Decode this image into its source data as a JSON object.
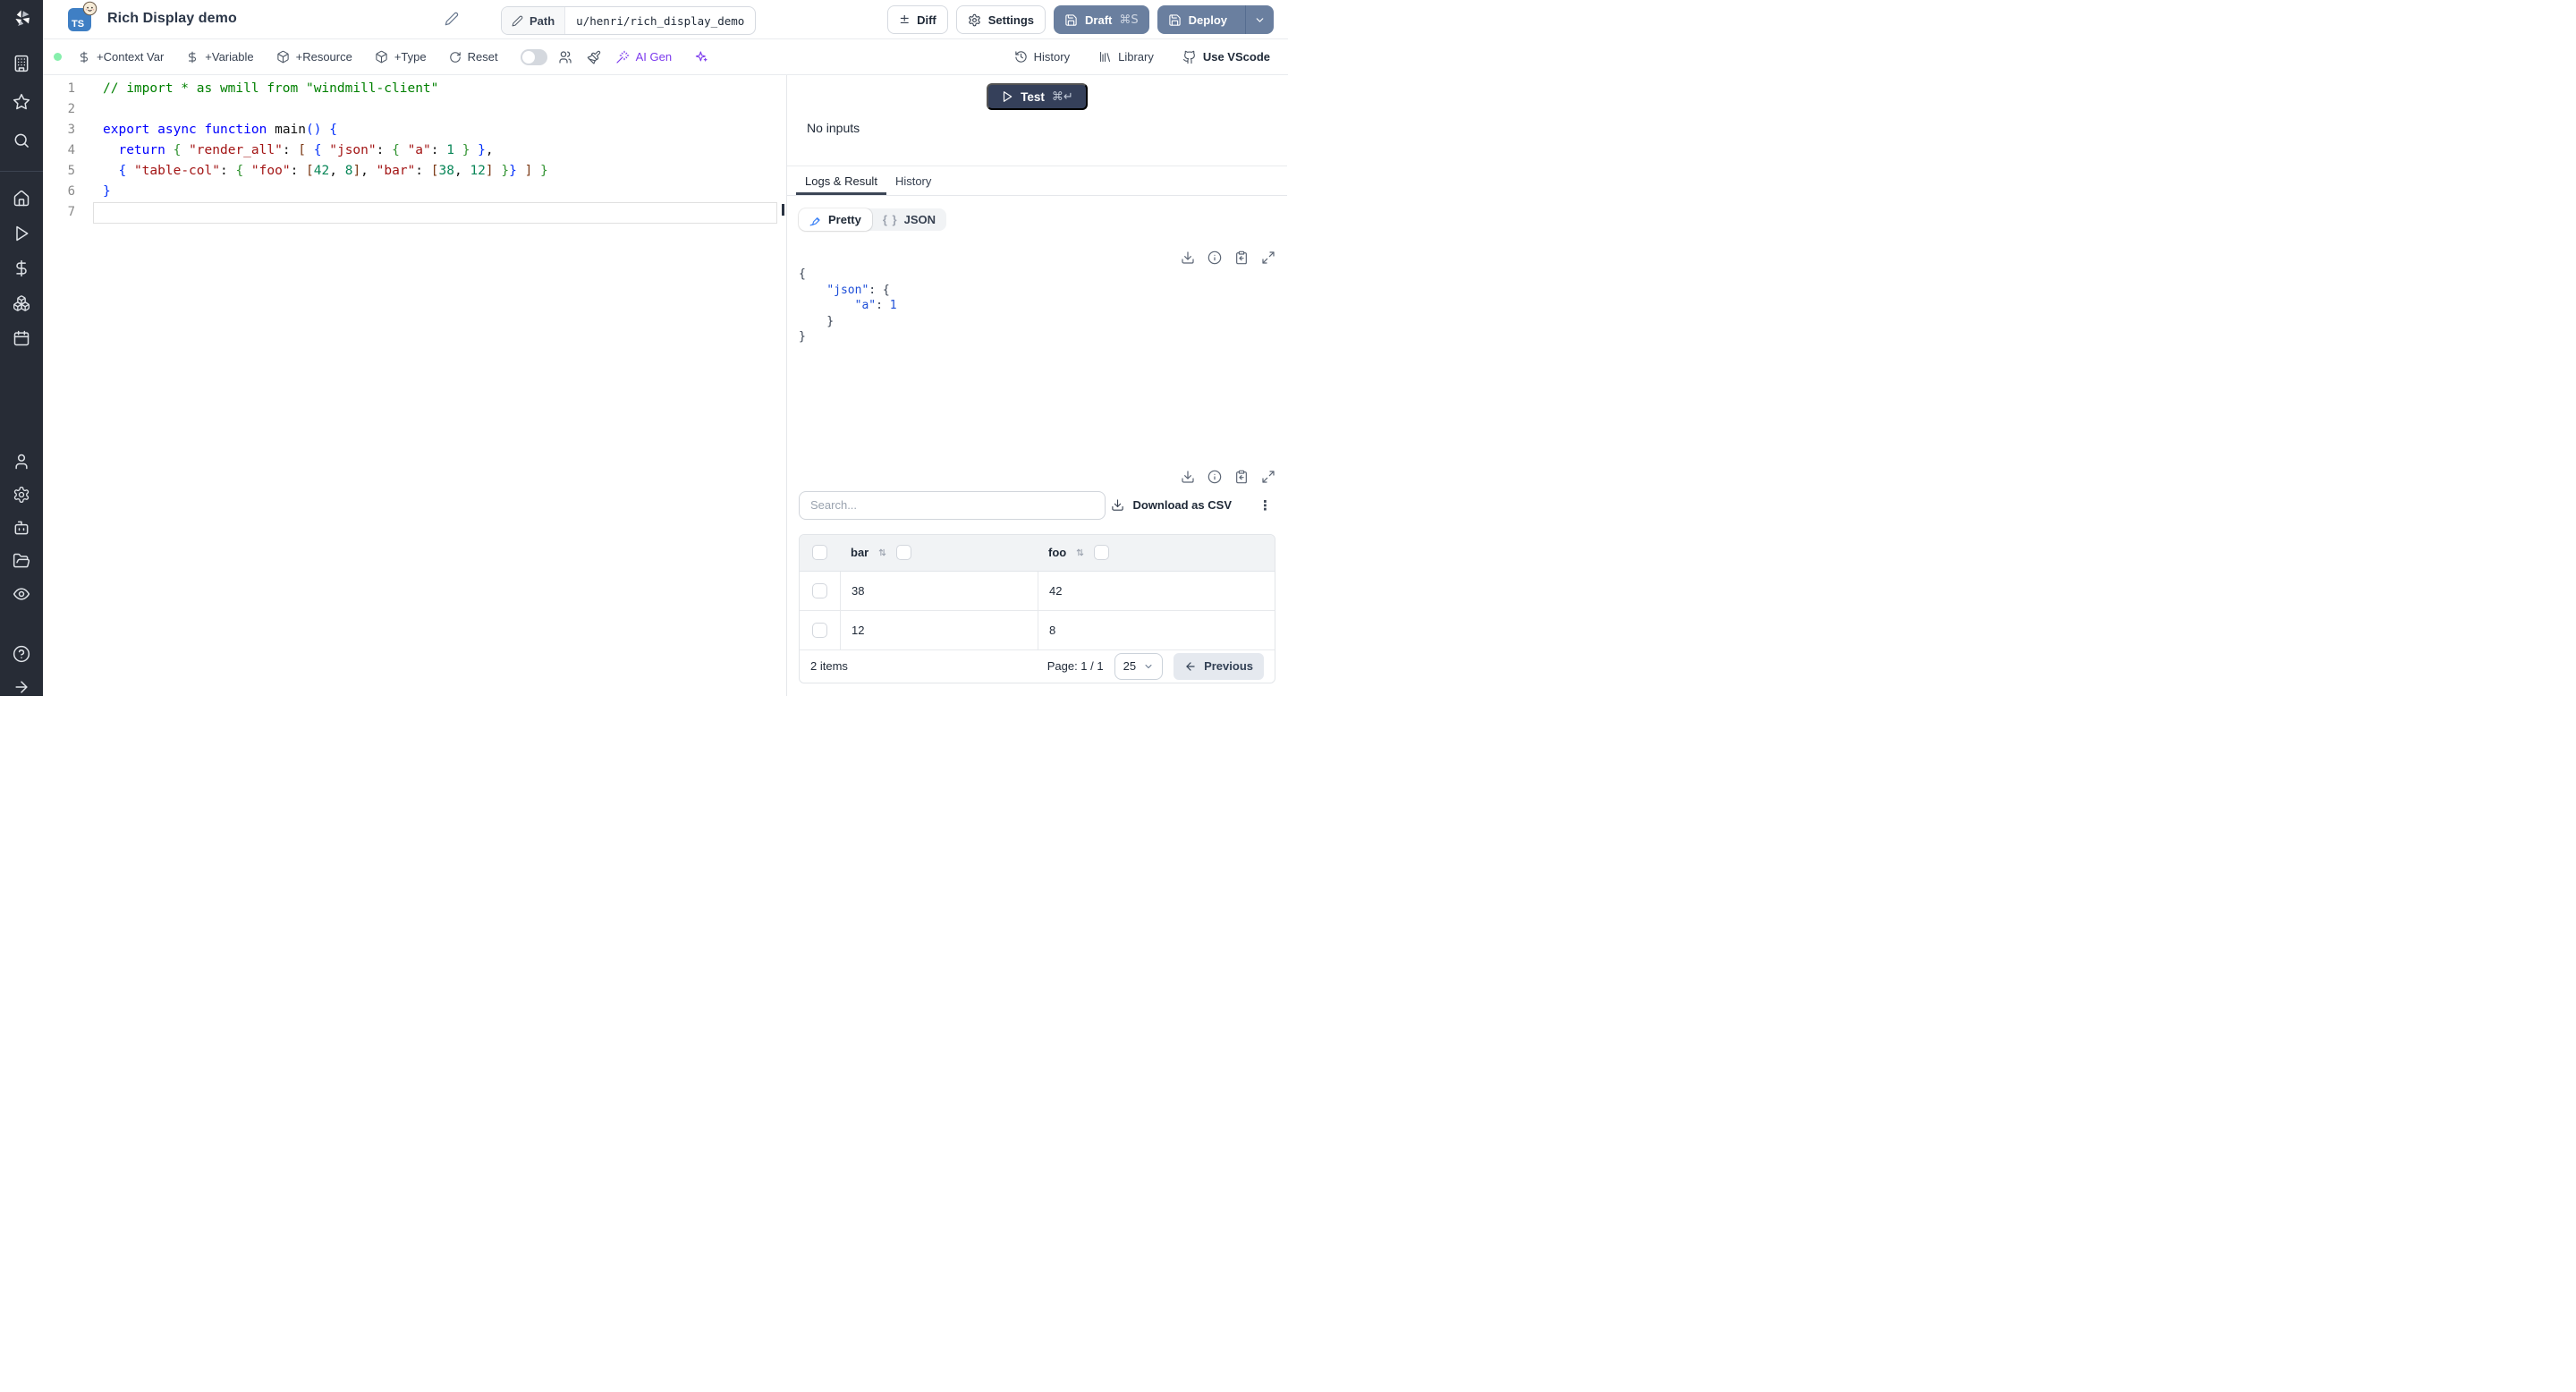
{
  "header": {
    "title": "Rich Display demo",
    "language_badge": "TS",
    "path_label": "Path",
    "path_value": "u/henri/rich_display_demo",
    "diff_label": "Diff",
    "settings_label": "Settings",
    "draft_label": "Draft",
    "draft_shortcut": "⌘S",
    "deploy_label": "Deploy"
  },
  "toolbar": {
    "context_var": "+Context Var",
    "variable": "+Variable",
    "resource": "+Resource",
    "type": "+Type",
    "reset": "Reset",
    "ai_gen": "AI Gen",
    "history": "History",
    "library": "Library",
    "vscode": "Use VScode"
  },
  "icons": {
    "plus_minus": "±",
    "kebab": "⋮",
    "braces": "{ }"
  },
  "editor": {
    "lines": [
      {
        "n": 1,
        "tokens": [
          {
            "c": "comment",
            "t": "// import * as wmill from \"windmill-client\""
          }
        ]
      },
      {
        "n": 2,
        "tokens": []
      },
      {
        "n": 3,
        "tokens": [
          {
            "c": "kw",
            "t": "export"
          },
          {
            "c": "plain",
            "t": " "
          },
          {
            "c": "kw",
            "t": "async"
          },
          {
            "c": "plain",
            "t": " "
          },
          {
            "c": "kw",
            "t": "function"
          },
          {
            "c": "plain",
            "t": " main"
          },
          {
            "c": "b1",
            "t": "()"
          },
          {
            "c": "plain",
            "t": " "
          },
          {
            "c": "b1",
            "t": "{"
          }
        ]
      },
      {
        "n": 4,
        "tokens": [
          {
            "c": "plain",
            "t": "  "
          },
          {
            "c": "kw",
            "t": "return"
          },
          {
            "c": "plain",
            "t": " "
          },
          {
            "c": "b2",
            "t": "{"
          },
          {
            "c": "plain",
            "t": " "
          },
          {
            "c": "str",
            "t": "\"render_all\""
          },
          {
            "c": "plain",
            "t": ": "
          },
          {
            "c": "b3",
            "t": "["
          },
          {
            "c": "plain",
            "t": " "
          },
          {
            "c": "b1",
            "t": "{"
          },
          {
            "c": "plain",
            "t": " "
          },
          {
            "c": "str",
            "t": "\"json\""
          },
          {
            "c": "plain",
            "t": ": "
          },
          {
            "c": "b2",
            "t": "{"
          },
          {
            "c": "plain",
            "t": " "
          },
          {
            "c": "str",
            "t": "\"a\""
          },
          {
            "c": "plain",
            "t": ": "
          },
          {
            "c": "num",
            "t": "1"
          },
          {
            "c": "plain",
            "t": " "
          },
          {
            "c": "b2",
            "t": "}"
          },
          {
            "c": "plain",
            "t": " "
          },
          {
            "c": "b1",
            "t": "}"
          },
          {
            "c": "plain",
            "t": ","
          }
        ]
      },
      {
        "n": 5,
        "tokens": [
          {
            "c": "plain",
            "t": "  "
          },
          {
            "c": "b1",
            "t": "{"
          },
          {
            "c": "plain",
            "t": " "
          },
          {
            "c": "str",
            "t": "\"table-col\""
          },
          {
            "c": "plain",
            "t": ": "
          },
          {
            "c": "b2",
            "t": "{"
          },
          {
            "c": "plain",
            "t": " "
          },
          {
            "c": "str",
            "t": "\"foo\""
          },
          {
            "c": "plain",
            "t": ": "
          },
          {
            "c": "b3",
            "t": "["
          },
          {
            "c": "num",
            "t": "42"
          },
          {
            "c": "plain",
            "t": ", "
          },
          {
            "c": "num",
            "t": "8"
          },
          {
            "c": "b3",
            "t": "]"
          },
          {
            "c": "plain",
            "t": ", "
          },
          {
            "c": "str",
            "t": "\"bar\""
          },
          {
            "c": "plain",
            "t": ": "
          },
          {
            "c": "b3",
            "t": "["
          },
          {
            "c": "num",
            "t": "38"
          },
          {
            "c": "plain",
            "t": ", "
          },
          {
            "c": "num",
            "t": "12"
          },
          {
            "c": "b3",
            "t": "]"
          },
          {
            "c": "plain",
            "t": " "
          },
          {
            "c": "b2",
            "t": "}"
          },
          {
            "c": "b1",
            "t": "}"
          },
          {
            "c": "plain",
            "t": " "
          },
          {
            "c": "b3",
            "t": "]"
          },
          {
            "c": "plain",
            "t": " "
          },
          {
            "c": "b2",
            "t": "}"
          }
        ]
      },
      {
        "n": 6,
        "tokens": [
          {
            "c": "b1",
            "t": "}"
          }
        ]
      },
      {
        "n": 7,
        "tokens": [],
        "current": true
      }
    ]
  },
  "run": {
    "test_label": "Test",
    "test_shortcut": "⌘↵",
    "no_inputs": "No inputs"
  },
  "tabs": {
    "logs_result": "Logs & Result",
    "history": "History",
    "active": "Logs & Result"
  },
  "result": {
    "view_modes": [
      "Pretty",
      "JSON"
    ],
    "active_mode": "Pretty",
    "json_lines": [
      [
        {
          "c": "p",
          "t": "{"
        }
      ],
      [
        {
          "c": "p",
          "t": "    "
        },
        {
          "c": "k",
          "t": "\"json\""
        },
        {
          "c": "p",
          "t": ": {"
        }
      ],
      [
        {
          "c": "p",
          "t": "        "
        },
        {
          "c": "k",
          "t": "\"a\""
        },
        {
          "c": "p",
          "t": ": "
        },
        {
          "c": "v",
          "t": "1"
        }
      ],
      [
        {
          "c": "p",
          "t": "    }"
        }
      ],
      [
        {
          "c": "p",
          "t": "}"
        }
      ]
    ],
    "value": {
      "json": {
        "a": 1
      }
    }
  },
  "table": {
    "search_placeholder": "Search...",
    "download_csv": "Download as CSV",
    "columns": [
      "bar",
      "foo"
    ],
    "rows": [
      [
        "38",
        "42"
      ],
      [
        "12",
        "8"
      ]
    ],
    "footer": {
      "items": "2 items",
      "page": "Page: 1 / 1",
      "page_size": "25",
      "previous": "Previous"
    }
  },
  "sidebar": {
    "items": [
      "workspace",
      "favorites",
      "search",
      "home",
      "runs",
      "variables",
      "resources",
      "schedules",
      "users",
      "settings",
      "workers",
      "folders",
      "audit-logs",
      "help",
      "expand-sidebar"
    ]
  },
  "colors": {
    "sidebar_bg": "#272c36",
    "primary_button": "#6a7f9f",
    "test_button": "#35405a",
    "ai_accent": "#7c3aed",
    "run_status_green": "#86efac",
    "ts_badge_blue": "#3f7fc4"
  }
}
